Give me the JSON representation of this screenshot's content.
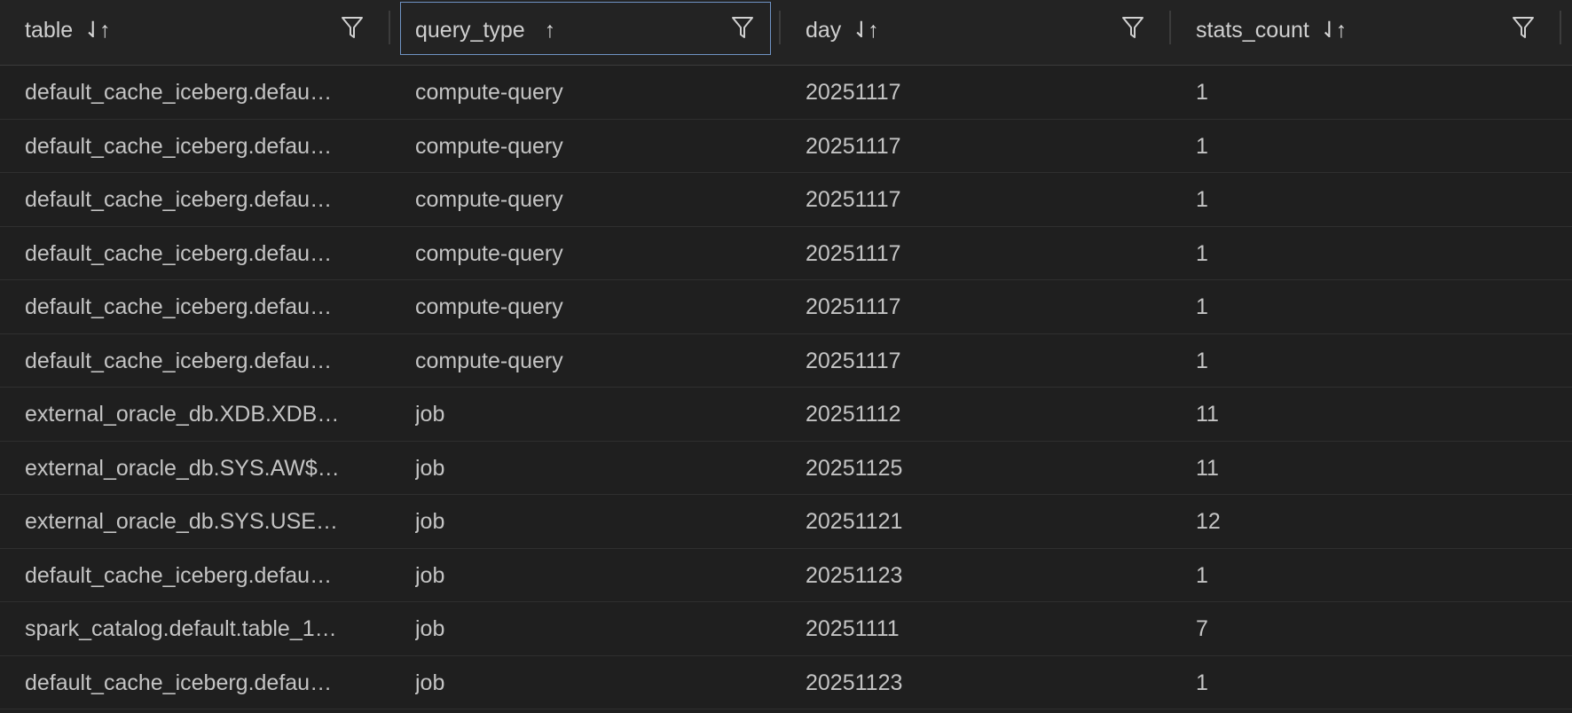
{
  "columns": [
    {
      "label": "table",
      "sort": "⇃↑",
      "filter_icon": "filter-icon"
    },
    {
      "label": "query_type",
      "sort": "↑",
      "filter_icon": "filter-icon"
    },
    {
      "label": "day",
      "sort": "⇃↑",
      "filter_icon": "filter-icon"
    },
    {
      "label": "stats_count",
      "sort": "⇃↑",
      "filter_icon": "filter-icon"
    }
  ],
  "rows": [
    [
      "default_cache_iceberg.defau…",
      "compute-query",
      "20251117",
      "1"
    ],
    [
      "default_cache_iceberg.defau…",
      "compute-query",
      "20251117",
      "1"
    ],
    [
      "default_cache_iceberg.defau…",
      "compute-query",
      "20251117",
      "1"
    ],
    [
      "default_cache_iceberg.defau…",
      "compute-query",
      "20251117",
      "1"
    ],
    [
      "default_cache_iceberg.defau…",
      "compute-query",
      "20251117",
      "1"
    ],
    [
      "default_cache_iceberg.defau…",
      "compute-query",
      "20251117",
      "1"
    ],
    [
      "external_oracle_db.XDB.XDB…",
      "job",
      "20251112",
      "11"
    ],
    [
      "external_oracle_db.SYS.AW$…",
      "job",
      "20251125",
      "11"
    ],
    [
      "external_oracle_db.SYS.USE…",
      "job",
      "20251121",
      "12"
    ],
    [
      "default_cache_iceberg.defau…",
      "job",
      "20251123",
      "1"
    ],
    [
      "spark_catalog.default.table_1…",
      "job",
      "20251111",
      "7"
    ],
    [
      "default_cache_iceberg.defau…",
      "job",
      "20251123",
      "1"
    ]
  ],
  "colors": {
    "background": "#1f1f1f",
    "header": "#232323",
    "focus_border": "#6f93c4",
    "text": "#c4c4c4"
  }
}
